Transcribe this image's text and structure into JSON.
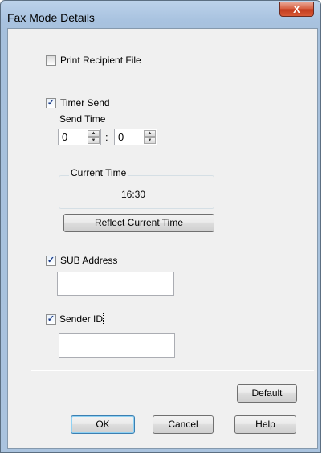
{
  "window": {
    "title": "Fax Mode Details",
    "close_glyph": "X"
  },
  "print_recipient_file": {
    "label": "Print Recipient File",
    "checked": false
  },
  "timer_send": {
    "label": "Timer Send",
    "checked": true,
    "send_time_label": "Send Time",
    "hour": "0",
    "separator": ":",
    "minute": "0",
    "spin_up_glyph": "▲",
    "spin_down_glyph": "▼"
  },
  "current_time": {
    "group_label": "Current Time",
    "value": "16:30"
  },
  "reflect_button": {
    "label": "Reflect Current Time"
  },
  "sub_address": {
    "label": "SUB Address",
    "checked": true,
    "value": ""
  },
  "sender_id": {
    "label": "Sender ID",
    "checked": true,
    "value": ""
  },
  "buttons": {
    "default": "Default",
    "ok": "OK",
    "cancel": "Cancel",
    "help": "Help"
  },
  "check_glyph": "✓"
}
